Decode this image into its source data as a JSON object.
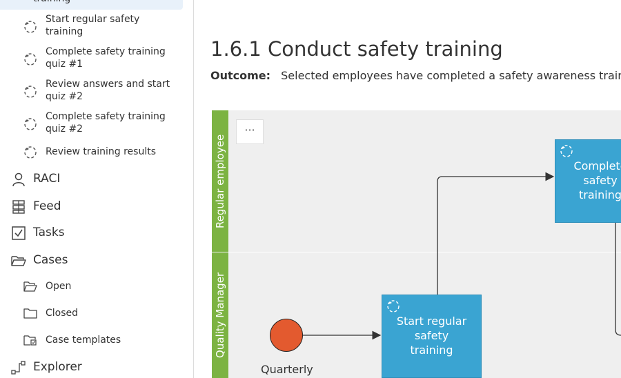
{
  "sidebar": {
    "selected_item": "training",
    "subprocess_items": [
      {
        "label": "Start regular safety training"
      },
      {
        "label": "Complete safety training quiz #1"
      },
      {
        "label": "Review answers and start quiz #2"
      },
      {
        "label": "Complete safety training quiz #2"
      },
      {
        "label": "Review training results"
      }
    ],
    "nav": {
      "raci": "RACI",
      "feed": "Feed",
      "tasks": "Tasks",
      "cases": "Cases",
      "explorer": "Explorer"
    },
    "cases_items": [
      {
        "label": "Open",
        "icon": "folder-open-icon"
      },
      {
        "label": "Closed",
        "icon": "folder-icon"
      },
      {
        "label": "Case templates",
        "icon": "case-template-icon"
      }
    ]
  },
  "main": {
    "title": "1.6.1 Conduct safety training",
    "outcome_label": "Outcome:",
    "outcome_text": "Selected employees have completed a safety awareness training"
  },
  "diagram": {
    "more_label": "···",
    "lanes": [
      {
        "label": "Regular employee"
      },
      {
        "label": "Quality Manager"
      }
    ],
    "tasks": {
      "start_regular": "Start regular safety training",
      "complete_quiz_partial": "Complete safety training"
    },
    "start_event_label": "Quarterly",
    "colors": {
      "lane": "#7cb342",
      "task": "#3aa4d2",
      "start_event": "#e35a2f",
      "background": "#efefef"
    }
  }
}
